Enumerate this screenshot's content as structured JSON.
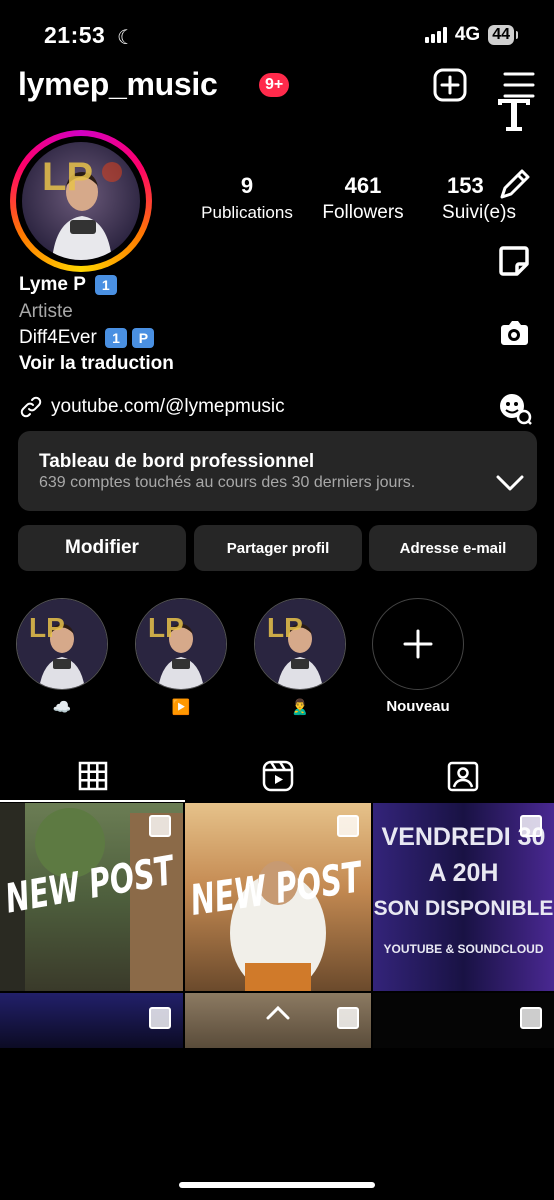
{
  "status_bar": {
    "time": "21:53",
    "network": "4G",
    "battery": "44"
  },
  "header": {
    "username": "lymep_music",
    "notifications": "9+"
  },
  "stats": [
    {
      "value": "9",
      "label": "Publications"
    },
    {
      "value": "461",
      "label": "Followers"
    },
    {
      "value": "153",
      "label": "Suivi(e)s"
    }
  ],
  "profile": {
    "name": "Lyme P",
    "name_badge": "1️⃣",
    "category": "Artiste",
    "bio_text": "Diff4Ever",
    "bio_badge1": "1",
    "bio_badge2": "P",
    "translate": "Voir la traduction",
    "link": "youtube.com/@lymepmusic"
  },
  "dashboard": {
    "title": "Tableau de bord professionnel",
    "subtitle": "639 comptes touchés au cours des 30 derniers jours."
  },
  "actions": {
    "edit": "Modifier",
    "share": "Partager profil",
    "email": "Adresse e-mail"
  },
  "highlights": [
    {
      "label": "☁️"
    },
    {
      "label": "▶️"
    },
    {
      "label": "🙎‍♂️"
    },
    {
      "label": "Nouveau"
    }
  ],
  "posts": [
    {
      "overlay": "NEW POST"
    },
    {
      "overlay": "NEW POST"
    },
    {
      "lines": [
        "VENDREDI 30",
        "A 20H",
        "SON DISPONIBLE",
        "YOUTUBE & SOUNDCLOUD"
      ]
    }
  ],
  "avatar_letters": "LP",
  "colors": {
    "accent_badge": "#ff2a4b",
    "panel": "#262626",
    "pill_blue": "#4a90e2"
  }
}
